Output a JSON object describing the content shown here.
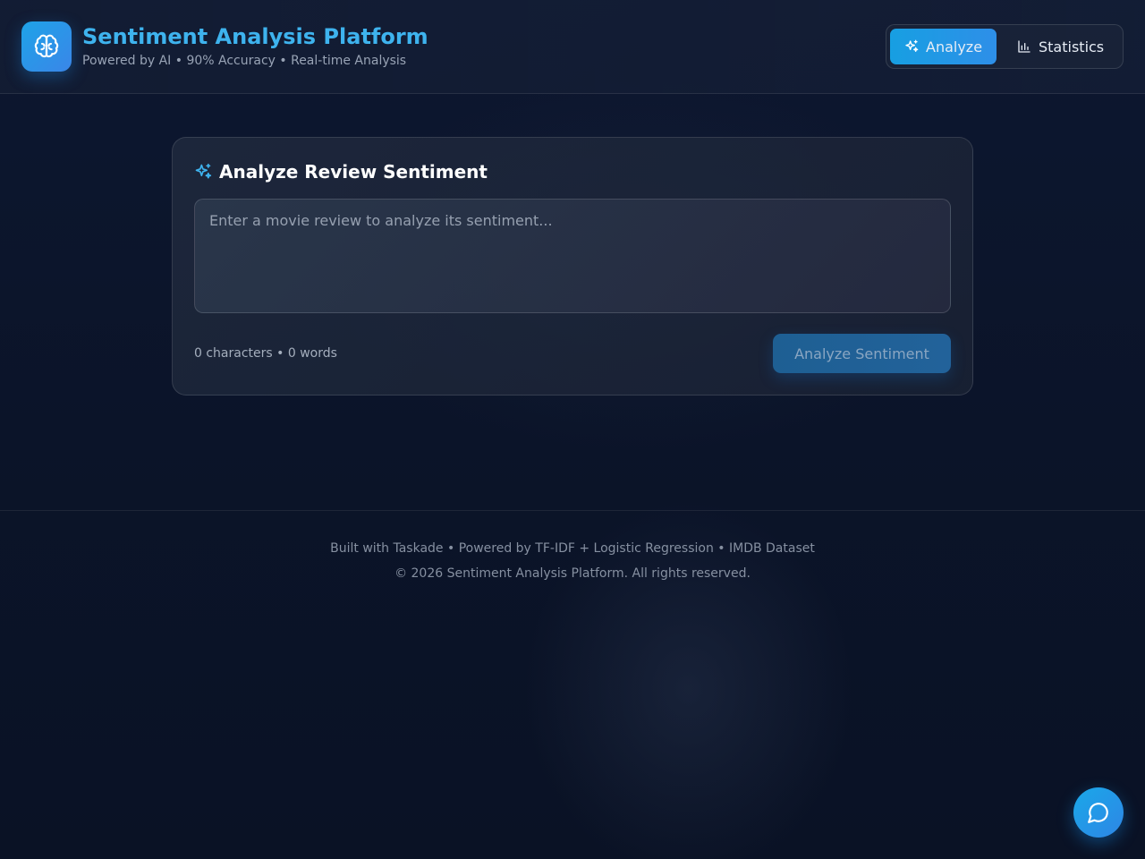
{
  "header": {
    "logo_icon": "brain-icon",
    "title": "Sentiment Analysis Platform",
    "subtitle": "Powered by AI • 90% Accuracy • Real-time Analysis",
    "nav": [
      {
        "label": "Analyze",
        "icon": "sparkles-icon",
        "active": true
      },
      {
        "label": "Statistics",
        "icon": "bar-chart-icon",
        "active": false
      }
    ]
  },
  "analyzer": {
    "title": "Analyze Review Sentiment",
    "title_icon": "sparkles-icon",
    "input_placeholder": "Enter a movie review to analyze its sentiment...",
    "input_value": "",
    "counts": "0 characters • 0 words",
    "submit_label": "Analyze Sentiment"
  },
  "footer": {
    "line1": "Built with Taskade • Powered by TF-IDF + Logistic Regression • IMDB Dataset",
    "line2": "© 2026 Sentiment Analysis Platform. All rights reserved."
  },
  "chat": {
    "icon": "chat-bubble-icon"
  },
  "colors": {
    "accent": "#3eb3ee",
    "button_gradient_start": "#179fe2",
    "background": "#0b1429"
  }
}
